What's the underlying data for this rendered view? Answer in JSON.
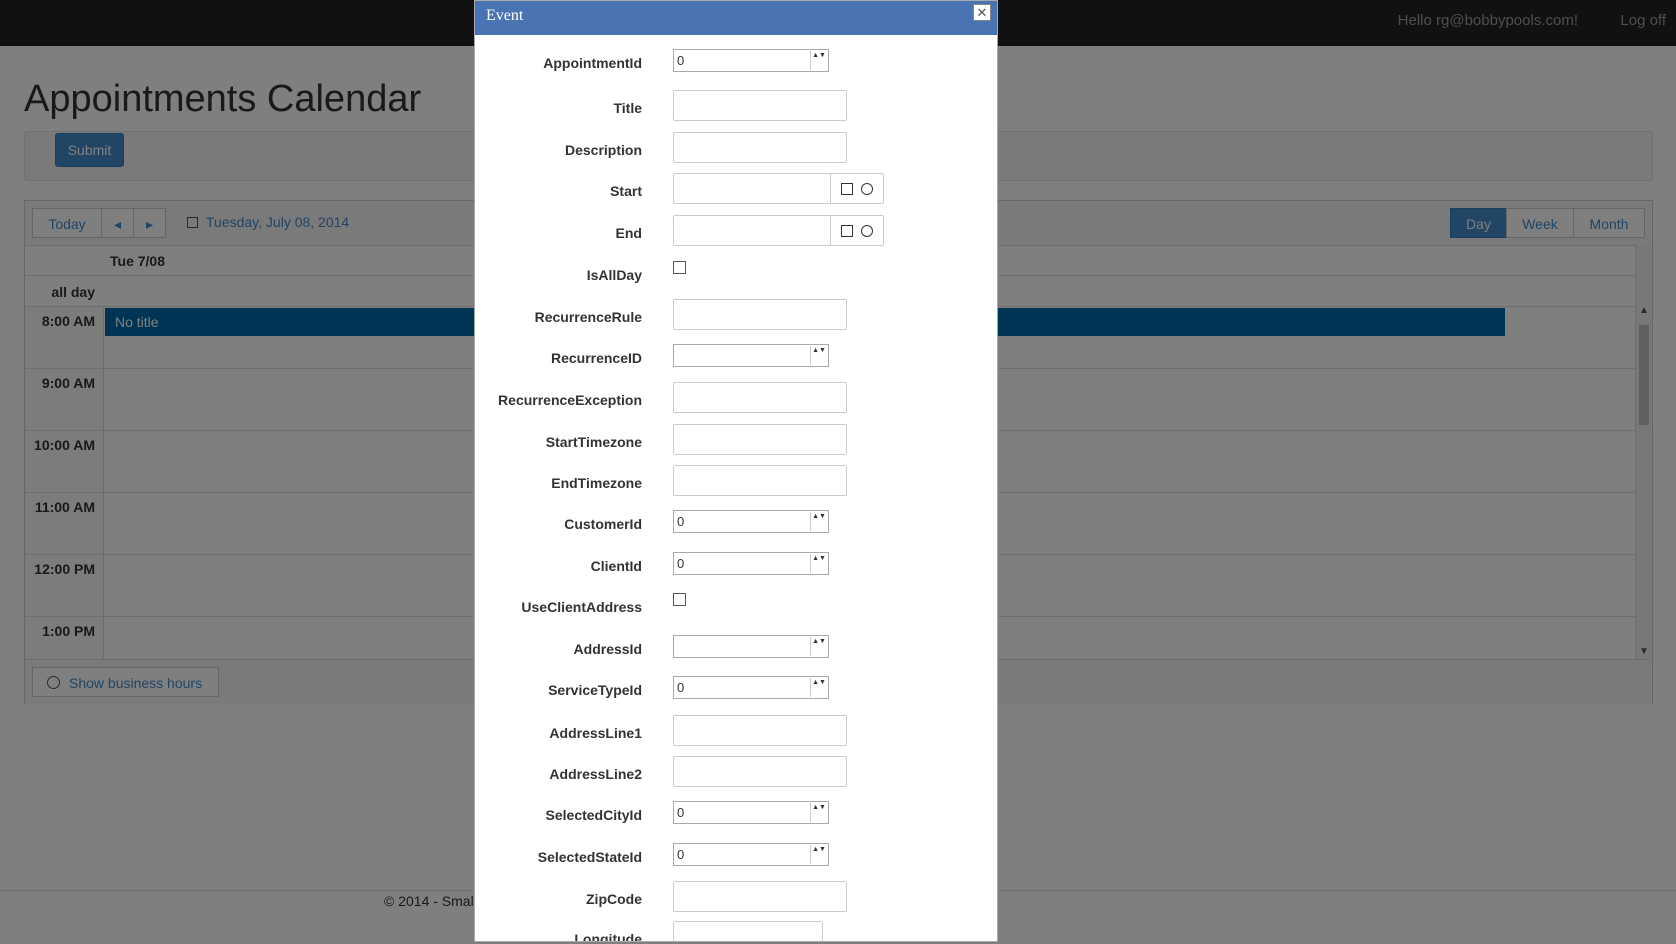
{
  "nav": {
    "greeting": "Hello rg@bobbypools.com!",
    "logoff": "Log off"
  },
  "page": {
    "title": "Appointments Calendar",
    "submit_label": "Submit",
    "footer": "© 2014 - Smal"
  },
  "scheduler": {
    "today": "Today",
    "prev": "◂",
    "next": "▸",
    "current_date": "Tuesday, July 08, 2014",
    "views": [
      "Day",
      "Week",
      "Month"
    ],
    "selected_view": "Day",
    "day_header": "Tue 7/08",
    "all_day_label": "all day",
    "times": [
      "8:00 AM",
      "9:00 AM",
      "10:00 AM",
      "11:00 AM",
      "12:00 PM",
      "1:00 PM"
    ],
    "event_title": "No title",
    "business_hours": "Show business hours"
  },
  "dialog": {
    "title": "Event",
    "close": "✕",
    "spin": "▲▼",
    "fields": [
      {
        "label": "AppointmentId",
        "type": "number",
        "value": "0"
      },
      {
        "label": "Title",
        "type": "text",
        "value": ""
      },
      {
        "label": "Description",
        "type": "text",
        "value": ""
      },
      {
        "label": "Start",
        "type": "datetime",
        "value": ""
      },
      {
        "label": "End",
        "type": "datetime",
        "value": ""
      },
      {
        "label": "IsAllDay",
        "type": "checkbox",
        "value": ""
      },
      {
        "label": "RecurrenceRule",
        "type": "text",
        "value": ""
      },
      {
        "label": "RecurrenceID",
        "type": "number",
        "value": ""
      },
      {
        "label": "RecurrenceException",
        "type": "text",
        "value": ""
      },
      {
        "label": "StartTimezone",
        "type": "text",
        "value": ""
      },
      {
        "label": "EndTimezone",
        "type": "text",
        "value": ""
      },
      {
        "label": "CustomerId",
        "type": "number",
        "value": "0"
      },
      {
        "label": "ClientId",
        "type": "number",
        "value": "0"
      },
      {
        "label": "UseClientAddress",
        "type": "checkbox",
        "value": ""
      },
      {
        "label": "AddressId",
        "type": "number",
        "value": ""
      },
      {
        "label": "ServiceTypeId",
        "type": "number",
        "value": "0"
      },
      {
        "label": "AddressLine1",
        "type": "text",
        "value": ""
      },
      {
        "label": "AddressLine2",
        "type": "text",
        "value": ""
      },
      {
        "label": "SelectedCityId",
        "type": "number",
        "value": "0"
      },
      {
        "label": "SelectedStateId",
        "type": "number",
        "value": "0"
      },
      {
        "label": "ZipCode",
        "type": "text",
        "value": ""
      },
      {
        "label": "Longitude",
        "type": "text",
        "value": ""
      }
    ]
  }
}
